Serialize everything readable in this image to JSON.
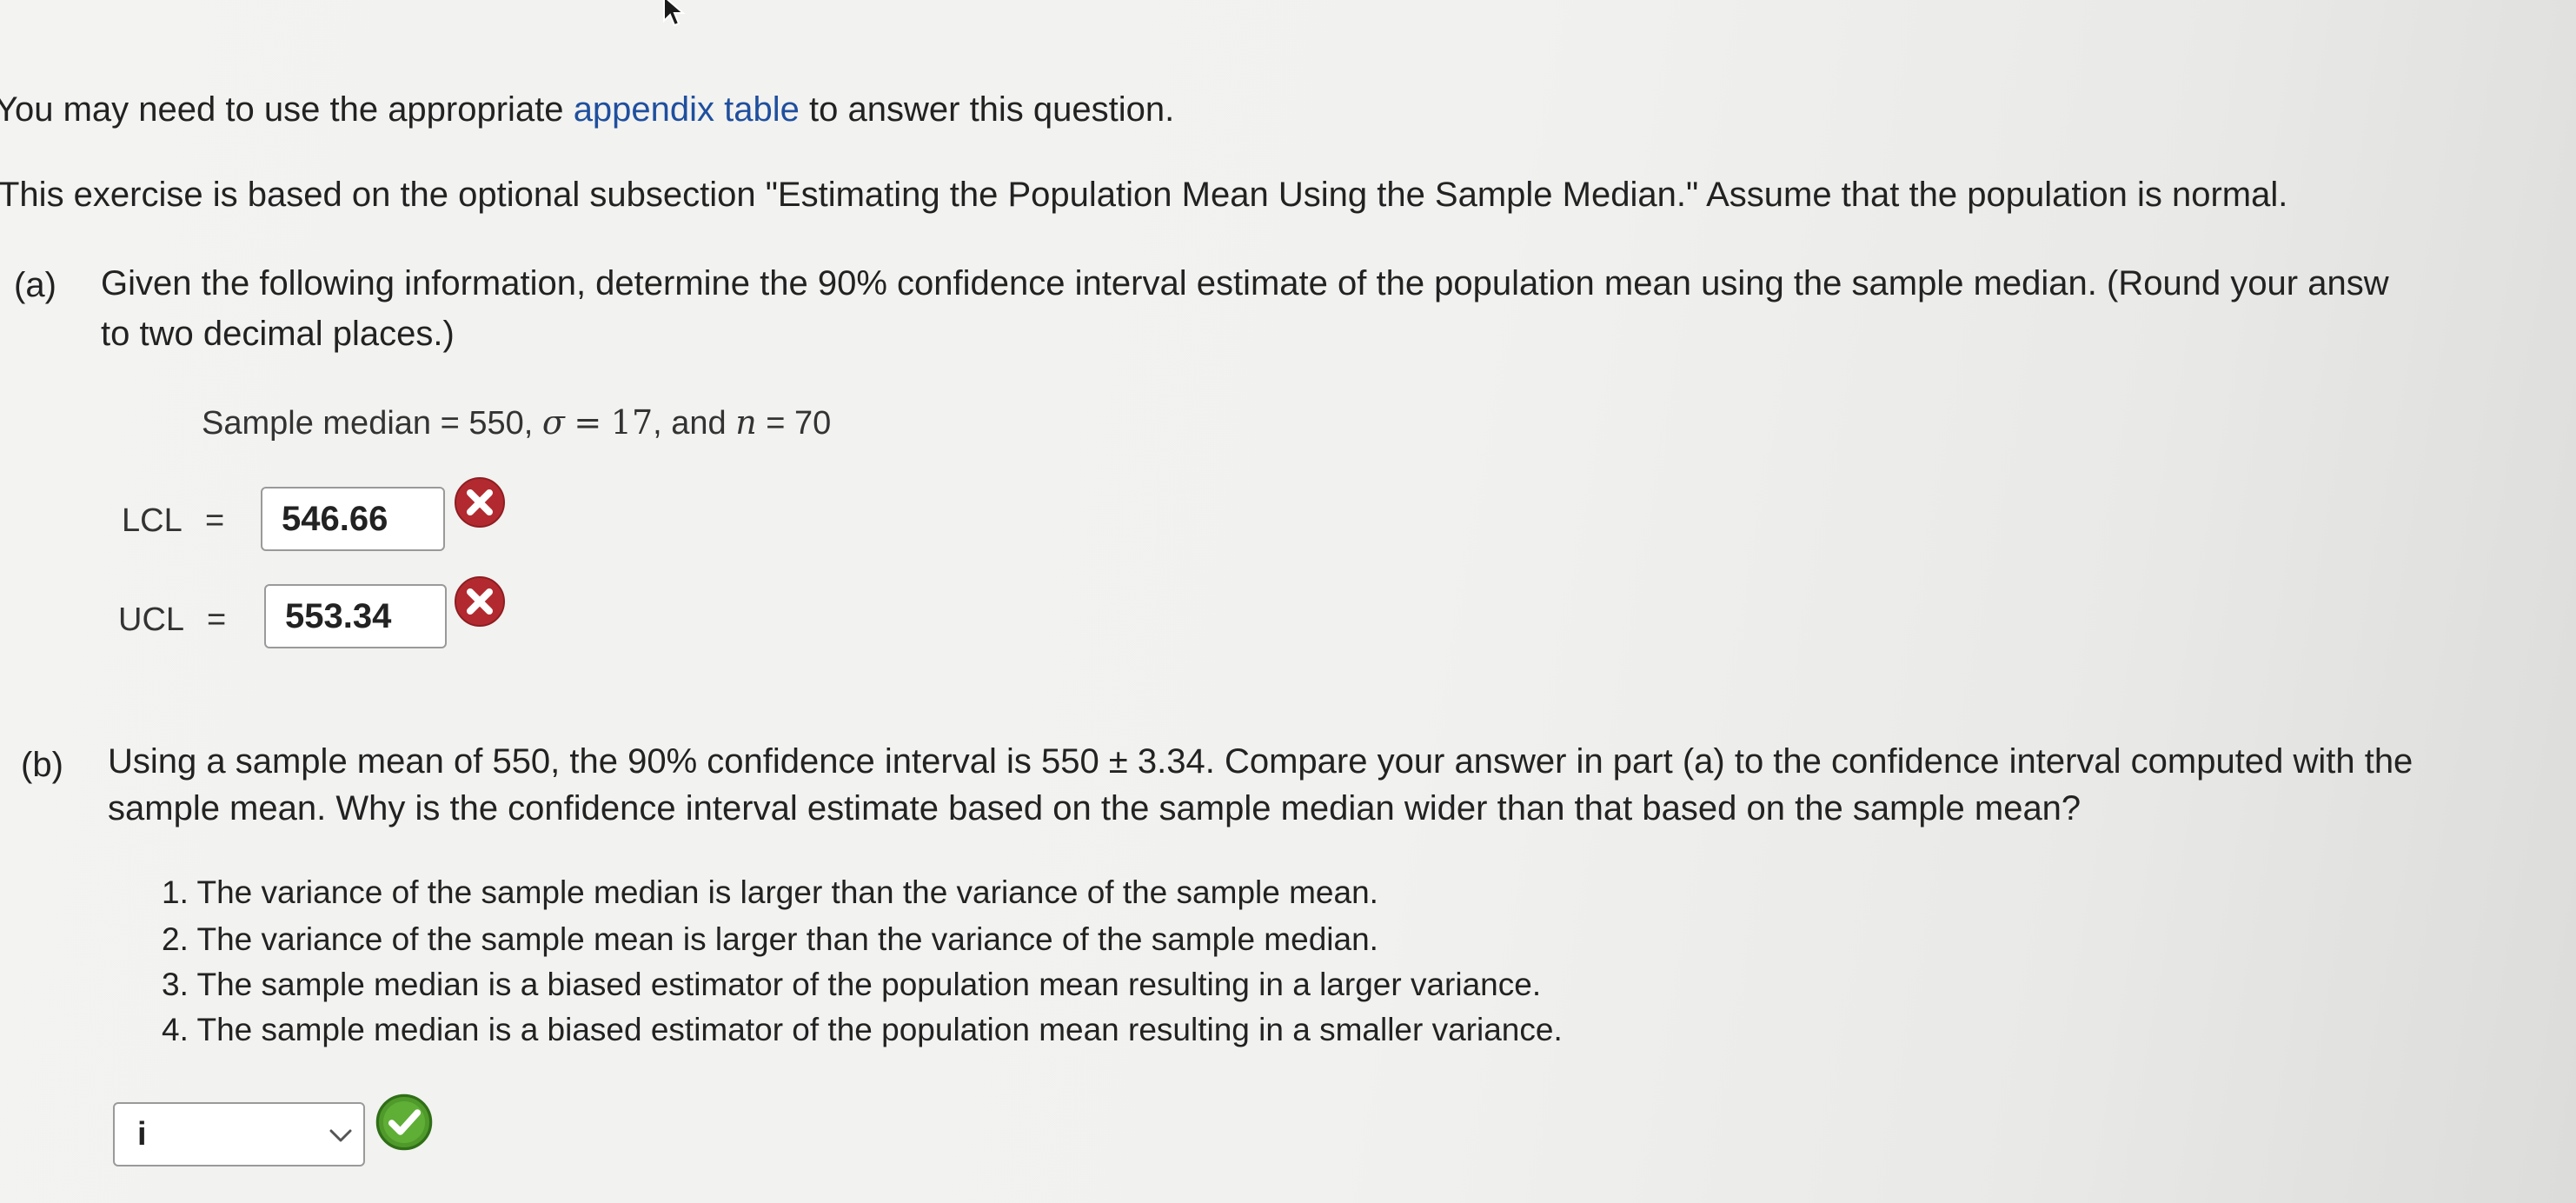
{
  "intro": {
    "prefix": "You may need to use the appropriate",
    "link": "appendix table",
    "suffix": "to answer this question."
  },
  "exercise_text": "This exercise is based on the optional subsection \"Estimating the Population Mean Using the Sample Median.\" Assume that the population is normal.",
  "part_a": {
    "label": "(a)",
    "line1": "Given the following information, determine the 90% confidence interval estimate of the population mean using the sample median. (Round your answ",
    "line2": "to two decimal places.)",
    "given": {
      "median_text": "Sample median = 550,",
      "sigma_symbol": "σ",
      "equals": "=",
      "sigma_value": "17",
      "and_text": ", and",
      "n_symbol": "n",
      "n_text": "= 70"
    },
    "lcl": {
      "label": "LCL",
      "equals": "=",
      "value": "546.66",
      "status": "incorrect"
    },
    "ucl": {
      "label": "UCL",
      "equals": "=",
      "value": "553.34",
      "status": "incorrect"
    }
  },
  "part_b": {
    "label": "(b)",
    "line1": "Using a sample mean of 550, the 90% confidence interval is 550 ± 3.34. Compare your answer in part (a) to the confidence interval computed with the",
    "line2": "sample mean. Why is the confidence interval estimate based on the sample median wider than that based on the sample mean?",
    "options": [
      "1. The variance of the sample median is larger than the variance of the sample mean.",
      "2. The variance of the sample mean is larger than the variance of the sample median.",
      "3. The sample median is a biased estimator of the population mean resulting in a larger variance.",
      "4. The sample median is a biased estimator of the population mean resulting in a smaller variance."
    ],
    "select": {
      "value": "i",
      "status": "correct"
    }
  },
  "icons": {
    "incorrect": "x-circle-icon",
    "correct": "check-circle-icon",
    "dropdown": "chevron-down-icon",
    "cursor": "mouse-pointer-icon"
  },
  "colors": {
    "link": "#1f4f9e",
    "incorrect": "#b22a2f",
    "correct": "#3f8f1f"
  }
}
